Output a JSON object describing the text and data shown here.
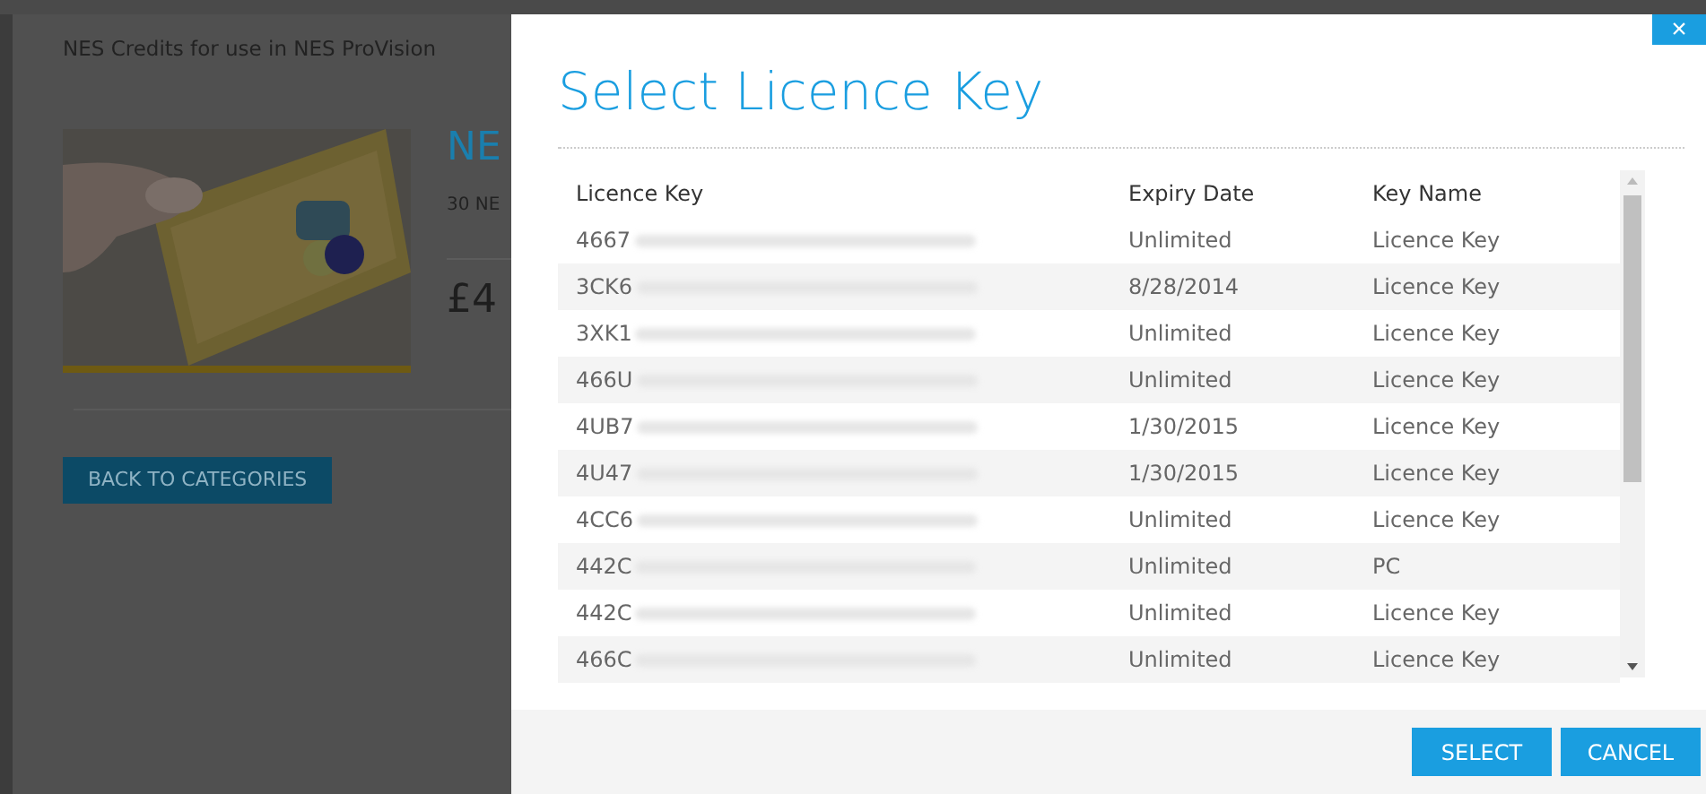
{
  "background_page": {
    "subtitle": "NES Credits for use in NES ProVision",
    "product_title": "NE",
    "product_description": "30 NE",
    "price": "£4",
    "back_button": "BACK TO CATEGORIES"
  },
  "dialog": {
    "title": "Select Licence Key",
    "close": "×",
    "table": {
      "columns": [
        "Licence Key",
        "Expiry Date",
        "Key Name"
      ],
      "rows": [
        {
          "key": "4667",
          "expiry": "Unlimited",
          "name": "Licence Key",
          "selected": false
        },
        {
          "key": "3CK6",
          "expiry": "8/28/2014",
          "name": "Licence Key",
          "selected": false
        },
        {
          "key": "3XK1",
          "expiry": "Unlimited",
          "name": "Licence Key",
          "selected": false
        },
        {
          "key": "466U",
          "expiry": "Unlimited",
          "name": "Licence Key",
          "selected": false
        },
        {
          "key": "4UB7",
          "expiry": "1/30/2015",
          "name": "Licence Key",
          "selected": false
        },
        {
          "key": "4U47",
          "expiry": "1/30/2015",
          "name": "Licence Key",
          "selected": false
        },
        {
          "key": "4CC6",
          "expiry": "Unlimited",
          "name": "Licence Key",
          "selected": false
        },
        {
          "key": "442C",
          "expiry": "Unlimited",
          "name": "PC",
          "selected": false
        },
        {
          "key": "442C",
          "expiry": "Unlimited",
          "name": "Licence Key",
          "selected": false
        },
        {
          "key": "466C",
          "expiry": "Unlimited",
          "name": "Licence Key",
          "selected": false
        }
      ]
    },
    "buttons": [
      "SELECT",
      "CANCEL"
    ]
  }
}
